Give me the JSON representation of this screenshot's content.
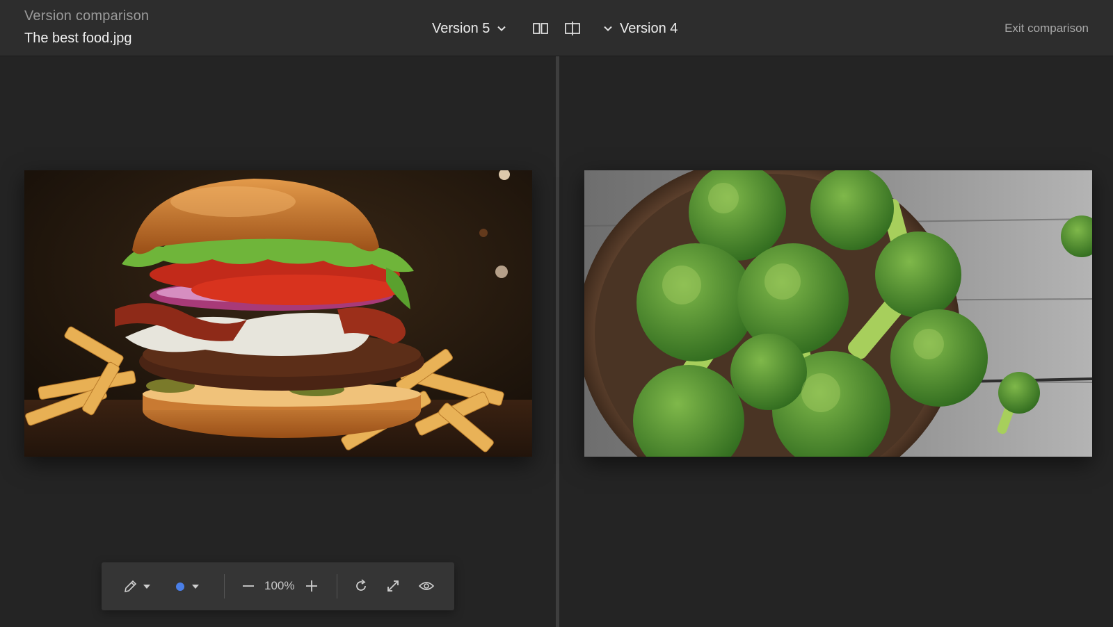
{
  "header": {
    "subtitle": "Version comparison",
    "filename": "The best food.jpg",
    "left_version": "Version 5",
    "right_version": "Version 4",
    "exit_label": "Exit comparison"
  },
  "panels": {
    "left": {
      "image": "burger-image"
    },
    "right": {
      "image": "broccoli-image"
    }
  },
  "toolbar": {
    "zoom": "100%",
    "pen_color": "#4a7fe8",
    "icons": [
      "pencil-icon",
      "caret-down-icon",
      "color-dot-icon",
      "minus-icon",
      "plus-icon",
      "rotate-icon",
      "expand-icon",
      "eye-icon"
    ]
  }
}
